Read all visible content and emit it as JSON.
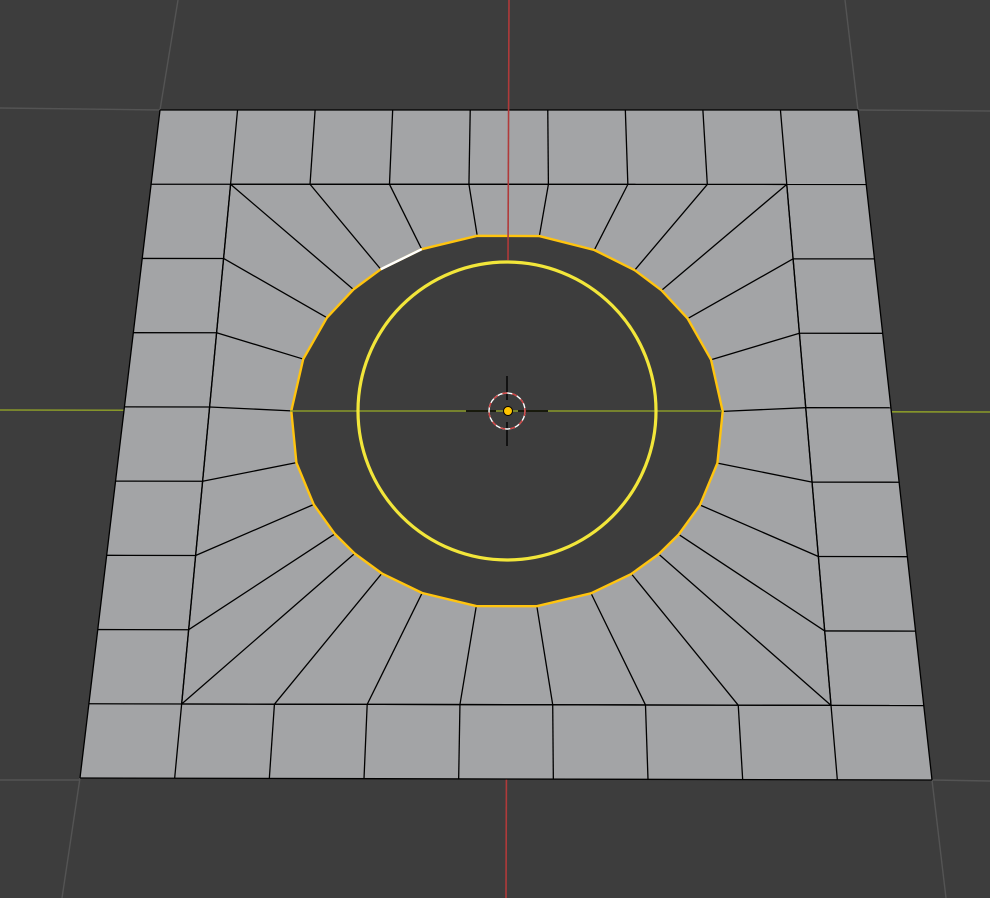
{
  "viewport": {
    "mode": "edit-mode",
    "background_color": "#3d3d3d",
    "grid_color": "#545454",
    "x_axis_color": "#8a9a2a",
    "y_axis_color": "#b03a3a"
  },
  "mesh": {
    "object": "plane-with-circular-hole",
    "face_color": "#a3a4a6",
    "edge_color": "#000000",
    "grid_columns": 9,
    "grid_rows": 9,
    "hole_vertex_count": 28,
    "selected_loop_color": "#ffc40f",
    "active_edge_color": "#ffffff"
  },
  "overlay": {
    "selection_circle_color": "#f2e63a",
    "pivot_color": "#ffc400",
    "cursor_ring_colors": [
      "#ffffff",
      "#d04040"
    ]
  }
}
